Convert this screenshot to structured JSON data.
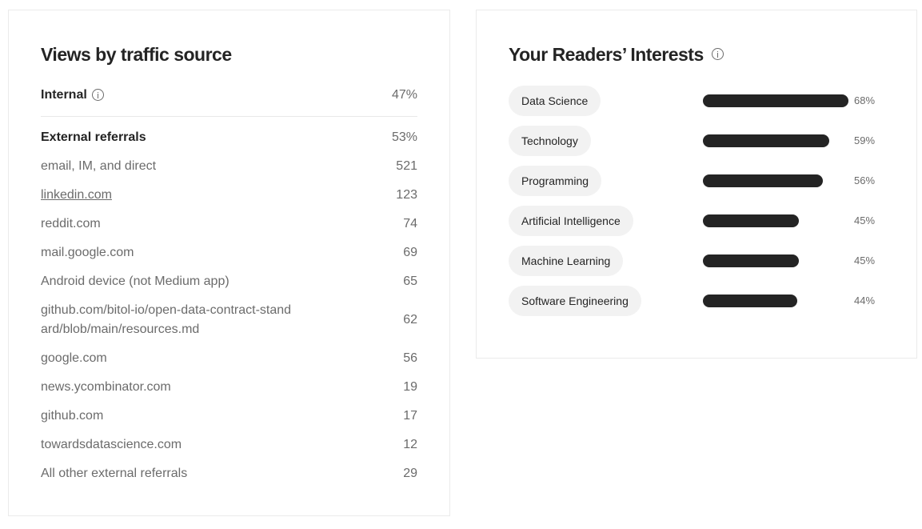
{
  "traffic": {
    "title": "Views by traffic source",
    "internal": {
      "label": "Internal",
      "value": "47%"
    },
    "external": {
      "label": "External referrals",
      "value": "53%"
    },
    "referrals": [
      {
        "label": "email, IM, and direct",
        "value": "521"
      },
      {
        "label": "linkedin.com",
        "value": "123"
      },
      {
        "label": "reddit.com",
        "value": "74"
      },
      {
        "label": "mail.google.com",
        "value": "69"
      },
      {
        "label": "Android device (not Medium app)",
        "value": "65"
      },
      {
        "label": "github.com/bitol-io/open-data-contract-standard/blob/main/resources.md",
        "value": "62"
      },
      {
        "label": "google.com",
        "value": "56"
      },
      {
        "label": "news.ycombinator.com",
        "value": "19"
      },
      {
        "label": "github.com",
        "value": "17"
      },
      {
        "label": "towardsdatascience.com",
        "value": "12"
      },
      {
        "label": "All other external referrals",
        "value": "29"
      }
    ]
  },
  "interests": {
    "title": "Your Readers’ Interests",
    "items": [
      {
        "label": "Data Science",
        "pct": "68%",
        "value": 68
      },
      {
        "label": "Technology",
        "pct": "59%",
        "value": 59
      },
      {
        "label": "Programming",
        "pct": "56%",
        "value": 56
      },
      {
        "label": "Artificial Intelligence",
        "pct": "45%",
        "value": 45
      },
      {
        "label": "Machine Learning",
        "pct": "45%",
        "value": 45
      },
      {
        "label": "Software Engineering",
        "pct": "44%",
        "value": 44
      }
    ]
  },
  "colors": {
    "bar": "#242424",
    "pill": "#f2f2f2",
    "muted": "#6b6b6b"
  }
}
